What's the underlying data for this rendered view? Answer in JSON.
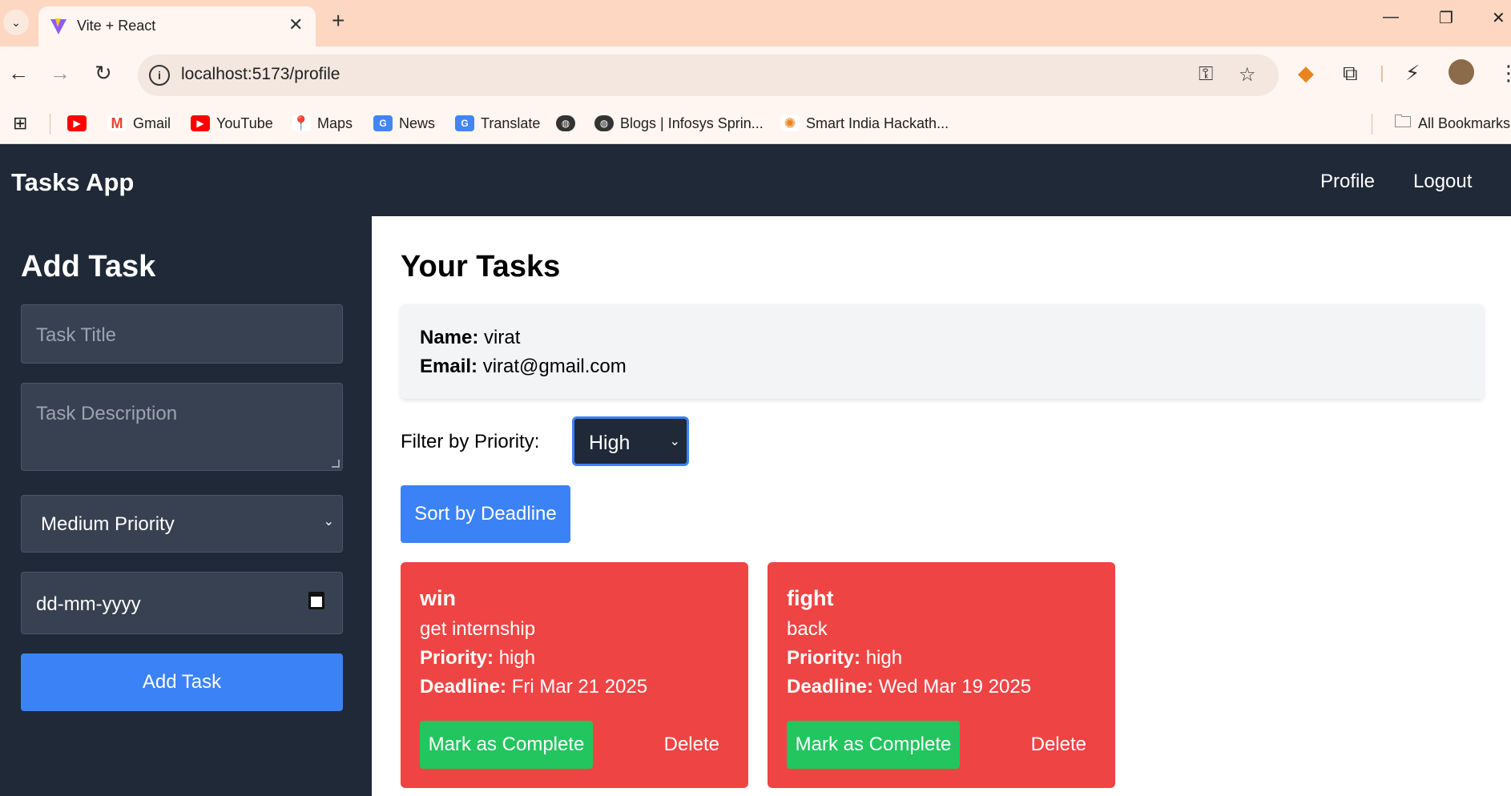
{
  "browser": {
    "tab_title": "Vite + React",
    "url": "localhost:5173/profile",
    "bookmarks": [
      {
        "label": "",
        "icon": "youtube-icon"
      },
      {
        "label": "Gmail",
        "icon": "gmail-icon"
      },
      {
        "label": "YouTube",
        "icon": "youtube-icon"
      },
      {
        "label": "Maps",
        "icon": "maps-icon"
      },
      {
        "label": "News",
        "icon": "news-icon"
      },
      {
        "label": "Translate",
        "icon": "translate-icon"
      },
      {
        "label": "",
        "icon": "globe-icon"
      },
      {
        "label": "Blogs | Infosys Sprin...",
        "icon": "globe-icon"
      },
      {
        "label": "Smart India Hackath...",
        "icon": "sih-icon"
      }
    ],
    "all_bookmarks": "All Bookmarks"
  },
  "app": {
    "brand": "Tasks App",
    "nav": {
      "profile": "Profile",
      "logout": "Logout"
    }
  },
  "sidebar": {
    "title": "Add Task",
    "title_placeholder": "Task Title",
    "description_placeholder": "Task Description",
    "priority_value": "Medium Priority",
    "date_placeholder": "dd-mm-yyyy",
    "add_button": "Add Task"
  },
  "main": {
    "title": "Your Tasks",
    "profile": {
      "name_label": "Name:",
      "name": "virat",
      "email_label": "Email:",
      "email": "virat@gmail.com"
    },
    "filter_label": "Filter by Priority:",
    "filter_value": "High",
    "sort_button": "Sort by Deadline",
    "tasks": [
      {
        "title": "win",
        "description": "get internship",
        "priority_label": "Priority:",
        "priority": "high",
        "deadline_label": "Deadline:",
        "deadline": "Fri Mar 21 2025",
        "complete_button": "Mark as Complete",
        "delete_button": "Delete"
      },
      {
        "title": "fight",
        "description": "back",
        "priority_label": "Priority:",
        "priority": "high",
        "deadline_label": "Deadline:",
        "deadline": "Wed Mar 19 2025",
        "complete_button": "Mark as Complete",
        "delete_button": "Delete"
      }
    ]
  },
  "colors": {
    "dark": "#1f2937",
    "input": "#374151",
    "primary": "#3b82f6",
    "danger": "#ef4444",
    "success": "#22c55e"
  }
}
